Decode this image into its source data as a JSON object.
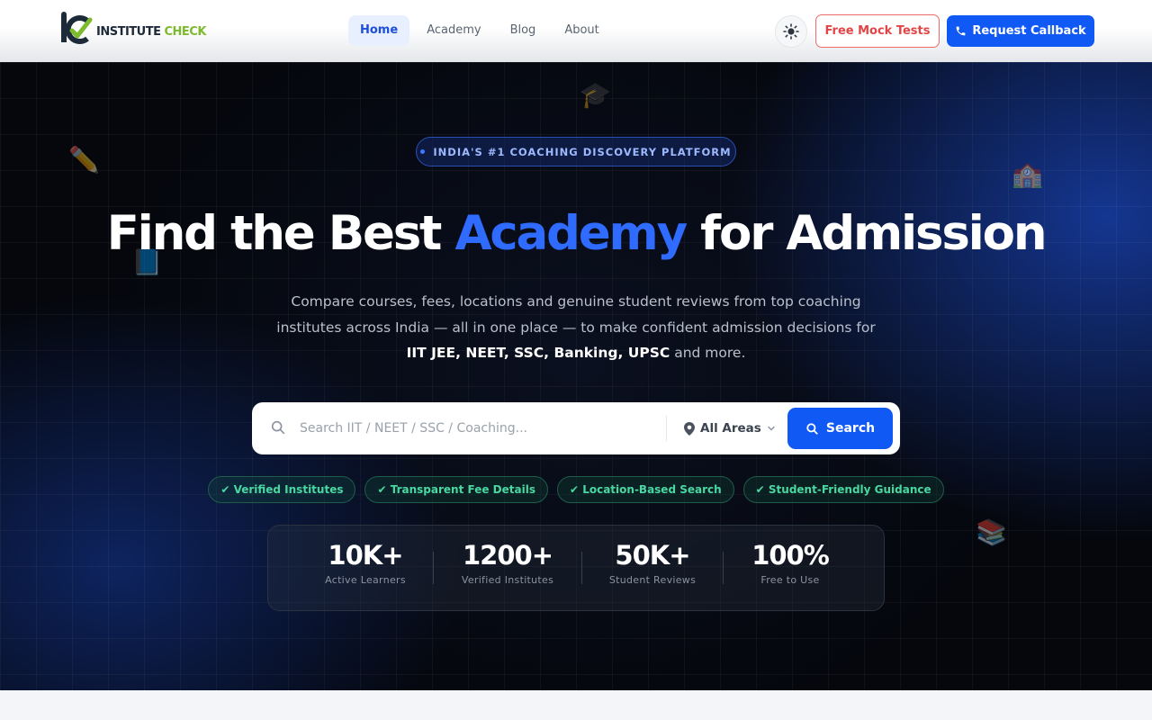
{
  "header": {
    "logo": {
      "word1": "INSTITUTE",
      "word2": "CHECK"
    },
    "nav": [
      {
        "label": "Home",
        "active": true
      },
      {
        "label": "Academy",
        "active": false
      },
      {
        "label": "Blog",
        "active": false
      },
      {
        "label": "About",
        "active": false
      }
    ],
    "theme_toggle_icon": "sun-icon",
    "mock_tests_label": "Free Mock Tests",
    "callback_label": "Request Callback"
  },
  "hero": {
    "badge": "INDIA'S #1 COACHING DISCOVERY PLATFORM",
    "headline": {
      "before": "Find the Best ",
      "accent": "Academy",
      "after": " for Admission"
    },
    "subtitle": {
      "text": "Compare courses, fees, locations and genuine student reviews from top coaching institutes across India — all in one place — to make confident admission decisions for ",
      "bold": "IIT JEE, NEET, SSC, Banking, UPSC",
      "end": " and more."
    },
    "search": {
      "placeholder": "Search IIT / NEET / SSC / Coaching...",
      "value": "",
      "area_selected": "All Areas",
      "button_label": "Search"
    },
    "features": [
      "✔ Verified Institutes",
      "✔ Transparent Fee Details",
      "✔ Location-Based Search",
      "✔ Student-Friendly Guidance"
    ],
    "stats": [
      {
        "value": "10K+",
        "label": "Active Learners"
      },
      {
        "value": "1200+",
        "label": "Verified Institutes"
      },
      {
        "value": "50K+",
        "label": "Student Reviews"
      },
      {
        "value": "100%",
        "label": "Free to Use"
      }
    ],
    "decor_icons": [
      "graduation-cap-icon",
      "pencil-icon",
      "school-icon",
      "book-icon",
      "books-icon"
    ]
  },
  "colors": {
    "primary": "#1159f5",
    "accent_text": "#2f6bff",
    "danger": "#e24545",
    "success": "#49d8a2",
    "hero_bg": "#05070d"
  }
}
